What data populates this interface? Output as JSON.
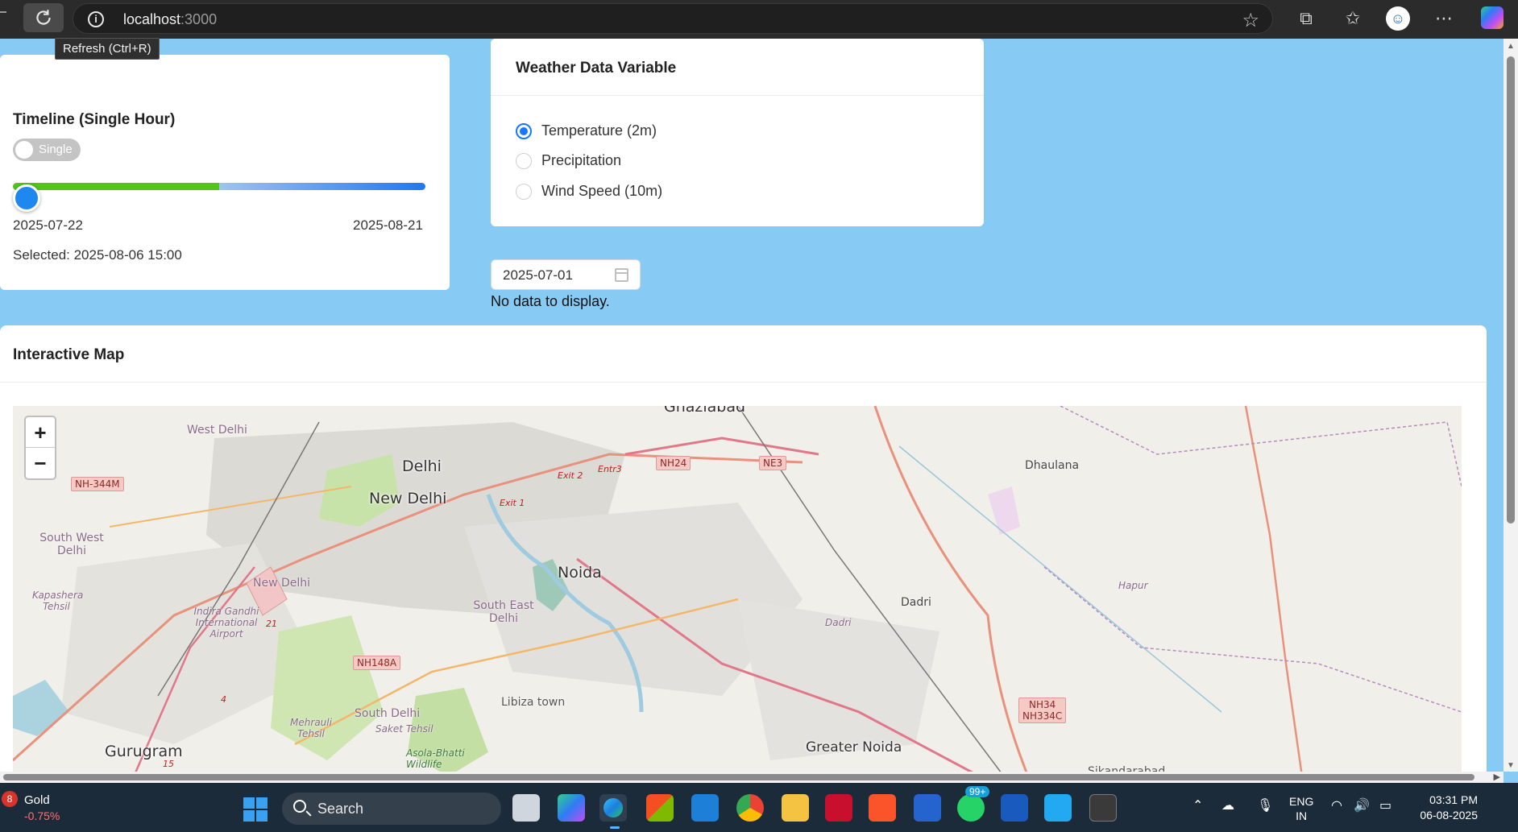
{
  "browser": {
    "url_host": "localhost",
    "url_port": ":3000",
    "tooltip": "Refresh (Ctrl+R)"
  },
  "timeline": {
    "title": "Timeline (Single Hour)",
    "toggle_label": "Single",
    "start_date": "2025-07-22",
    "end_date": "2025-08-21",
    "selected": "Selected: 2025-08-06 15:00",
    "fill_fraction": 0.5
  },
  "weather": {
    "title": "Weather Data Variable",
    "options": [
      {
        "label": "Temperature (2m)",
        "checked": true
      },
      {
        "label": "Precipitation",
        "checked": false
      },
      {
        "label": "Wind Speed (10m)",
        "checked": false
      }
    ]
  },
  "date_picker": {
    "value": "2025-07-01"
  },
  "status": {
    "no_data": "No data to display."
  },
  "map": {
    "title": "Interactive Map",
    "zoom_in": "+",
    "zoom_out": "−",
    "labels": {
      "ghaziabad": "Ghaziabad",
      "west_delhi": "West Delhi",
      "delhi": "Delhi",
      "new_delhi": "New Delhi",
      "south_west_delhi": "South West Delhi",
      "new_delhi_small": "New Delhi",
      "kapashera": "Kapashera Tehsil",
      "igi_airport": "Indira Gandhi International Airport",
      "noida": "Noida",
      "south_east_delhi": "South East Delhi",
      "south_delhi": "South Delhi",
      "saket_tehsil": "Saket Tehsil",
      "mehrauli": "Mehrauli Tehsil",
      "asola": "Asola-Bhatti Wildlife",
      "libiza": "Libiza town",
      "gurugram": "Gurugram",
      "dadri": "Dadri",
      "dadri_tehsil": "Dadri",
      "greater_noida": "Greater Noida",
      "dhaulana": "Dhaulana",
      "hapur": "Hapur",
      "sikandarabad": "Sikandarabad",
      "nh344m": "NH-344M",
      "nh24": "NH24",
      "ne3": "NE3",
      "nh148a": "NH148A",
      "nh34": "NH34",
      "nh334c": "NH334C",
      "exit1": "Exit 1",
      "exit2": "Exit 2",
      "exit3": "Entr3",
      "route21": "21",
      "route4": "4",
      "route15": "15"
    }
  },
  "taskbar": {
    "ticker_count": "8",
    "ticker_name": "Gold",
    "ticker_change": "-0.75%",
    "search_placeholder": "Search",
    "whatsapp_badge": "99+",
    "lang_top": "ENG",
    "lang_bottom": "IN",
    "time": "03:31 PM",
    "date": "06-08-2025"
  },
  "colors": {
    "page_bg": "#87cbf5",
    "accent": "#1677ff",
    "slider_fill": "#52c41a"
  }
}
